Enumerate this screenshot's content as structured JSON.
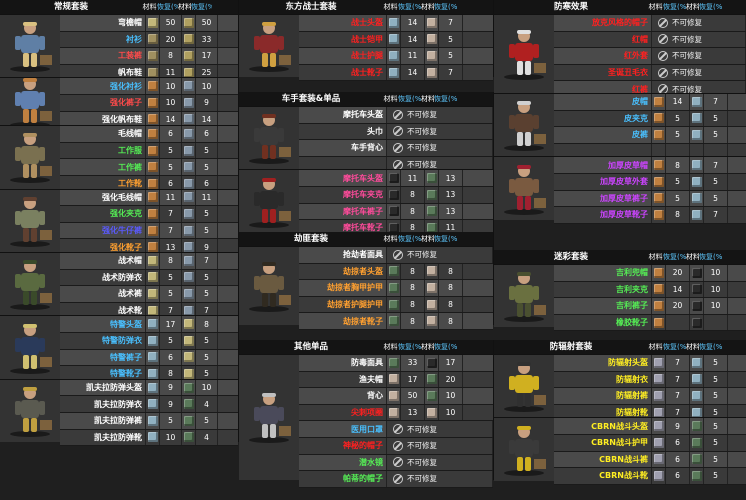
{
  "headers": {
    "material": "材料",
    "repair": "恢复(%)"
  },
  "unrepairable": "不可修复",
  "sections": [
    {
      "id": "regular",
      "title": "常规套装",
      "groups": [
        {
          "avatar": "fisherman",
          "colors": {
            "body": "#5f7fa5",
            "accent": "#d9c080"
          },
          "rows": [
            {
              "name": "弯檐帽",
              "color": "#ffffff",
              "mat1": "#c2b77a",
              "q1": "50",
              "mat2": "#b0a060",
              "q2": "50"
            },
            {
              "name": "衬衫",
              "color": "#49c0ff",
              "mat1": "#a09060",
              "q1": "20",
              "mat2": "#b0a060",
              "q2": "33"
            },
            {
              "name": "工装裤",
              "color": "#ff4b4b",
              "mat1": "#a09060",
              "q1": "8",
              "mat2": "#b0a060",
              "q2": "17"
            },
            {
              "name": "帆布鞋",
              "color": "#ffffff",
              "mat1": "#a09060",
              "q1": "11",
              "mat2": "#b0a060",
              "q2": "25"
            }
          ]
        },
        {
          "avatar": "box-carrier",
          "colors": {
            "body": "#6080b0",
            "accent": "#c08040"
          },
          "rows": [
            {
              "name": "强化衬衫",
              "color": "#49c0ff",
              "mat1": "#c08040",
              "q1": "10",
              "mat2": "#8899aa",
              "q2": "10"
            },
            {
              "name": "强化裤子",
              "color": "#ff4b4b",
              "mat1": "#c08040",
              "q1": "10",
              "mat2": "#8899aa",
              "q2": "9"
            },
            {
              "name": "强化帆布鞋",
              "color": "#ffffff",
              "mat1": "#c08040",
              "q1": "14",
              "mat2": "#8899aa",
              "q2": "14"
            }
          ]
        },
        {
          "avatar": "crouched",
          "colors": {
            "body": "#7a7050",
            "accent": "#b09060"
          },
          "rows": [
            {
              "name": "毛线帽",
              "color": "#ffffff",
              "mat1": "#c08040",
              "q1": "6",
              "mat2": "#8899aa",
              "q2": "6"
            },
            {
              "name": "工作服",
              "color": "#55ee55",
              "mat1": "#c08040",
              "q1": "5",
              "mat2": "#8899aa",
              "q2": "5"
            },
            {
              "name": "工作裤",
              "color": "#55ee55",
              "mat1": "#c08040",
              "q1": "5",
              "mat2": "#8899aa",
              "q2": "5"
            },
            {
              "name": "工作靴",
              "color": "#ffa030",
              "mat1": "#c08040",
              "q1": "6",
              "mat2": "#8899aa",
              "q2": "6"
            }
          ]
        },
        {
          "avatar": "jacket",
          "colors": {
            "body": "#7a8060",
            "accent": "#604030"
          },
          "rows": [
            {
              "name": "强化毛线帽",
              "color": "#ffffff",
              "mat1": "#c08040",
              "q1": "11",
              "mat2": "#8899aa",
              "q2": "11"
            },
            {
              "name": "强化夹克",
              "color": "#55ee55",
              "mat1": "#c08040",
              "q1": "7",
              "mat2": "#8899aa",
              "q2": "5"
            },
            {
              "name": "强化牛仔裤",
              "color": "#5a5aff",
              "mat1": "#c08040",
              "q1": "7",
              "mat2": "#8899aa",
              "q2": "5"
            },
            {
              "name": "强化靴子",
              "color": "#ffa030",
              "mat1": "#c08040",
              "q1": "13",
              "mat2": "#8899aa",
              "q2": "9"
            }
          ]
        },
        {
          "avatar": "soldier",
          "colors": {
            "body": "#5a6a40",
            "accent": "#3a4a2a"
          },
          "rows": [
            {
              "name": "战术帽",
              "color": "#ffffff",
              "mat1": "#c2b77a",
              "q1": "8",
              "mat2": "#8899aa",
              "q2": "7"
            },
            {
              "name": "战术防弹衣",
              "color": "#ffffff",
              "mat1": "#c2b77a",
              "q1": "5",
              "mat2": "#8899aa",
              "q2": "5"
            },
            {
              "name": "战术裤",
              "color": "#ffffff",
              "mat1": "#c2b77a",
              "q1": "5",
              "mat2": "#8899aa",
              "q2": "5"
            },
            {
              "name": "战术靴",
              "color": "#ffffff",
              "mat1": "#c2b77a",
              "q1": "7",
              "mat2": "#8899aa",
              "q2": "7"
            }
          ]
        },
        {
          "avatar": "swat",
          "colors": {
            "body": "#2a3a5a",
            "accent": "#d0c070"
          },
          "rows": [
            {
              "name": "特警头盔",
              "color": "#49c0ff",
              "mat1": "#90b0c0",
              "q1": "17",
              "mat2": "#c2b77a",
              "q2": "8"
            },
            {
              "name": "特警防弹衣",
              "color": "#49c0ff",
              "mat1": "#90b0c0",
              "q1": "5",
              "mat2": "#c2b77a",
              "q2": "5"
            },
            {
              "name": "特警裤子",
              "color": "#49c0ff",
              "mat1": "#90b0c0",
              "q1": "6",
              "mat2": "#c2b77a",
              "q2": "5"
            },
            {
              "name": "特警靴子",
              "color": "#49c0ff",
              "mat1": "#90b0c0",
              "q1": "8",
              "mat2": "#c2b77a",
              "q2": "5"
            }
          ]
        },
        {
          "avatar": "kevlar",
          "colors": {
            "body": "#5a5a50",
            "accent": "#c0a040"
          },
          "rows": [
            {
              "name": "凯夫拉防弹头盔",
              "color": "#ffffff",
              "mat1": "#90b0c0",
              "q1": "9",
              "mat2": "#5a7a5a",
              "q2": "10"
            },
            {
              "name": "凯夫拉防弹衣",
              "color": "#ffffff",
              "mat1": "#90b0c0",
              "q1": "9",
              "mat2": "#5a7a5a",
              "q2": "4"
            },
            {
              "name": "凯夫拉防弹裤",
              "color": "#ffffff",
              "mat1": "#90b0c0",
              "q1": "5",
              "mat2": "#5a7a5a",
              "q2": "5"
            },
            {
              "name": "凯夫拉防弹靴",
              "color": "#ffffff",
              "mat1": "#90b0c0",
              "q1": "10",
              "mat2": "#5a7a5a",
              "q2": "4"
            }
          ]
        }
      ]
    },
    {
      "id": "eastern",
      "title": "东方战士套装",
      "groups": [
        {
          "avatar": "warrior",
          "colors": {
            "body": "#8a2a2a",
            "accent": "#d0a040"
          },
          "rows": [
            {
              "name": "战士头盔",
              "color": "#ff2020",
              "mat1": "#90b0c0",
              "q1": "14",
              "mat2": "#c2b0a0",
              "q2": "7"
            },
            {
              "name": "战士铠甲",
              "color": "#ff2020",
              "mat1": "#90b0c0",
              "q1": "14",
              "mat2": "#c2b0a0",
              "q2": "5"
            },
            {
              "name": "战士护腿",
              "color": "#ff2020",
              "mat1": "#90b0c0",
              "q1": "11",
              "mat2": "#c2b0a0",
              "q2": "5"
            },
            {
              "name": "战士靴子",
              "color": "#ff2020",
              "mat1": "#90b0c0",
              "q1": "14",
              "mat2": "#c2b0a0",
              "q2": "7"
            }
          ]
        }
      ]
    },
    {
      "id": "rider",
      "title": "车手套装&单品",
      "groups": [
        {
          "avatar": "rider",
          "colors": {
            "body": "#3a3a3a",
            "accent": "#703020"
          },
          "rows": [
            {
              "name": "摩托车头盔",
              "color": "#ffffff",
              "merged": true
            },
            {
              "name": "头巾",
              "color": "#ffffff",
              "merged": true
            },
            {
              "name": "车手背心",
              "color": "#ffffff",
              "merged": true
            },
            {
              "name": "",
              "color": "#ffffff",
              "merged": true
            }
          ]
        },
        {
          "avatar": "moto",
          "colors": {
            "body": "#2a2a2a",
            "accent": "#a02020"
          },
          "rows": [
            {
              "name": "摩托车头盔",
              "color": "#ff4b9b",
              "mat1": "#2a2a2a",
              "q1": "11",
              "mat2": "#5a7a5a",
              "q2": "13"
            },
            {
              "name": "摩托车夹克",
              "color": "#ff4b9b",
              "mat1": "#2a2a2a",
              "q1": "8",
              "mat2": "#5a7a5a",
              "q2": "13"
            },
            {
              "name": "摩托车裤子",
              "color": "#ff4b9b",
              "mat1": "#2a2a2a",
              "q1": "8",
              "mat2": "#5a7a5a",
              "q2": "13"
            },
            {
              "name": "摩托车靴子",
              "color": "#ff4b9b",
              "mat1": "#2a2a2a",
              "q1": "8",
              "mat2": "#5a7a5a",
              "q2": "11"
            }
          ]
        }
      ]
    },
    {
      "id": "raider",
      "title": "劫匪套装",
      "groups": [
        {
          "avatar": "raider",
          "colors": {
            "body": "#6a5a40",
            "accent": "#302a20"
          },
          "rows": [
            {
              "name": "抢劫者面具",
              "color": "#ffffff",
              "merged": true
            },
            {
              "name": "劫掠者头盔",
              "color": "#ffa030",
              "mat1": "#5a7a5a",
              "q1": "8",
              "mat2": "#c2b0a0",
              "q2": "8"
            },
            {
              "name": "劫掠者胸甲护甲",
              "color": "#ffa030",
              "mat1": "#5a7a5a",
              "q1": "8",
              "mat2": "#c2b0a0",
              "q2": "8"
            },
            {
              "name": "劫掠者护腿护甲",
              "color": "#ffa030",
              "mat1": "#5a7a5a",
              "q1": "8",
              "mat2": "#c2b0a0",
              "q2": "8"
            },
            {
              "name": "劫掠者靴子",
              "color": "#ffa030",
              "mat1": "#5a7a5a",
              "q1": "8",
              "mat2": "#c2b0a0",
              "q2": "8"
            }
          ]
        }
      ]
    },
    {
      "id": "other",
      "title": "其他单品",
      "groups": [
        {
          "avatar": "items",
          "colors": {
            "body": "#4a4a5a",
            "accent": "#c0c0c0"
          },
          "rows": [
            {
              "name": "防毒面具",
              "color": "#ffffff",
              "mat1": "#5a7a5a",
              "q1": "33",
              "mat2": "#2a2a2a",
              "q2": "17"
            },
            {
              "name": "渔夫帽",
              "color": "#ffffff",
              "mat1": "#c2b0a0",
              "q1": "17",
              "mat2": "#5a7a5a",
              "q2": "20"
            },
            {
              "name": "背心",
              "color": "#ffffff",
              "mat1": "#c2b0a0",
              "q1": "50",
              "mat2": "#5a7a5a",
              "q2": "10"
            },
            {
              "name": "尖刺项圈",
              "color": "#ff2020",
              "mat1": "#c2b0a0",
              "q1": "13",
              "mat2": "#c2b0a0",
              "q2": "10"
            },
            {
              "name": "医用口罩",
              "color": "#49c0ff",
              "merged": true
            },
            {
              "name": "神秘的帽子",
              "color": "#ff2020",
              "merged": true
            },
            {
              "name": "潜水镜",
              "color": "#55ee55",
              "merged": true
            },
            {
              "name": "帕蒂的帽子",
              "color": "#55ee55",
              "merged": true
            }
          ]
        }
      ]
    },
    {
      "id": "cold",
      "title": "防寒效果",
      "groups": [
        {
          "avatar": "santa",
          "colors": {
            "body": "#b02020",
            "accent": "#e0e0e0"
          },
          "rows": [
            {
              "name": "放克风格的帽子",
              "color": "#ff2020",
              "merged": true
            },
            {
              "name": "红帽",
              "color": "#ff2020",
              "merged": true
            },
            {
              "name": "红外套",
              "color": "#ff2020",
              "merged": true
            },
            {
              "name": "圣诞丑毛衣",
              "color": "#ff2020",
              "merged": true
            },
            {
              "name": "红裤",
              "color": "#ff2020",
              "merged": true
            }
          ]
        },
        {
          "avatar": "leather",
          "colors": {
            "body": "#5a4030",
            "accent": "#d0d0d0"
          },
          "rows": [
            {
              "name": "皮帽",
              "color": "#49c0ff",
              "mat1": "#c08040",
              "q1": "14",
              "mat2": "#90b0c0",
              "q2": "7"
            },
            {
              "name": "皮夹克",
              "color": "#49c0ff",
              "mat1": "#c08040",
              "q1": "5",
              "mat2": "#90b0c0",
              "q2": "5"
            },
            {
              "name": "皮裤",
              "color": "#49c0ff",
              "mat1": "#c08040",
              "q1": "5",
              "mat2": "#90b0c0",
              "q2": "5"
            },
            {
              "name": "",
              "color": "#ffffff",
              "mat1": "",
              "q1": "",
              "mat2": "",
              "q2": ""
            }
          ]
        },
        {
          "avatar": "thick",
          "colors": {
            "body": "#7a5a40",
            "accent": "#a02030"
          },
          "rows": [
            {
              "name": "加厚皮草帽",
              "color": "#cc44ff",
              "mat1": "#c08040",
              "q1": "8",
              "mat2": "#90b0c0",
              "q2": "7"
            },
            {
              "name": "加厚皮草外套",
              "color": "#cc44ff",
              "mat1": "#c08040",
              "q1": "5",
              "mat2": "#90b0c0",
              "q2": "5"
            },
            {
              "name": "加厚皮草裤子",
              "color": "#cc44ff",
              "mat1": "#c08040",
              "q1": "5",
              "mat2": "#90b0c0",
              "q2": "5"
            },
            {
              "name": "加厚皮草靴子",
              "color": "#cc44ff",
              "mat1": "#c08040",
              "q1": "8",
              "mat2": "#90b0c0",
              "q2": "7"
            }
          ]
        }
      ]
    },
    {
      "id": "camo",
      "title": "迷彩套装",
      "groups": [
        {
          "avatar": "ghillie",
          "colors": {
            "body": "#6a7040",
            "accent": "#4a5030"
          },
          "rows": [
            {
              "name": "吉利兜帽",
              "color": "#55ee55",
              "mat1": "#c08040",
              "q1": "20",
              "mat2": "#2a2a2a",
              "q2": "10"
            },
            {
              "name": "吉利夹克",
              "color": "#55ee55",
              "mat1": "#c08040",
              "q1": "14",
              "mat2": "#2a2a2a",
              "q2": "10"
            },
            {
              "name": "吉利裤子",
              "color": "#55ee55",
              "mat1": "#c08040",
              "q1": "20",
              "mat2": "#2a2a2a",
              "q2": "10"
            },
            {
              "name": "橡胶靴子",
              "color": "#55ee55",
              "mat1": "#c08040",
              "q1": "",
              "mat2": "#2a2a2a",
              "q2": ""
            }
          ]
        }
      ]
    },
    {
      "id": "rad",
      "title": "防辐射套装",
      "groups": [
        {
          "avatar": "hazmat",
          "colors": {
            "body": "#d0b020",
            "accent": "#303030"
          },
          "rows": [
            {
              "name": "防辐射头盔",
              "color": "#ffee22",
              "mat1": "#a0a0b0",
              "q1": "7",
              "mat2": "#90b0c0",
              "q2": "5"
            },
            {
              "name": "防辐射衣",
              "color": "#ffee22",
              "mat1": "#a0a0b0",
              "q1": "7",
              "mat2": "#90b0c0",
              "q2": "5"
            },
            {
              "name": "防辐射裤",
              "color": "#ffee22",
              "mat1": "#a0a0b0",
              "q1": "7",
              "mat2": "#90b0c0",
              "q2": "5"
            },
            {
              "name": "防辐射靴",
              "color": "#ffee22",
              "mat1": "#a0a0b0",
              "q1": "7",
              "mat2": "#90b0c0",
              "q2": "5"
            }
          ]
        },
        {
          "avatar": "cbrn",
          "colors": {
            "body": "#3a3a3a",
            "accent": "#d0b020"
          },
          "rows": [
            {
              "name": "CBRN战斗头盔",
              "color": "#ffee22",
              "mat1": "#a0a0b0",
              "q1": "9",
              "mat2": "#5a7a5a",
              "q2": "5"
            },
            {
              "name": "CBRN战斗护甲",
              "color": "#ffee22",
              "mat1": "#a0a0b0",
              "q1": "6",
              "mat2": "#5a7a5a",
              "q2": "5"
            },
            {
              "name": "CBRN战斗裤",
              "color": "#ffee22",
              "mat1": "#a0a0b0",
              "q1": "6",
              "mat2": "#5a7a5a",
              "q2": "5"
            },
            {
              "name": "CBRN战斗靴",
              "color": "#ffee22",
              "mat1": "#a0a0b0",
              "q1": "6",
              "mat2": "#5a7a5a",
              "q2": "5"
            }
          ]
        }
      ]
    }
  ]
}
